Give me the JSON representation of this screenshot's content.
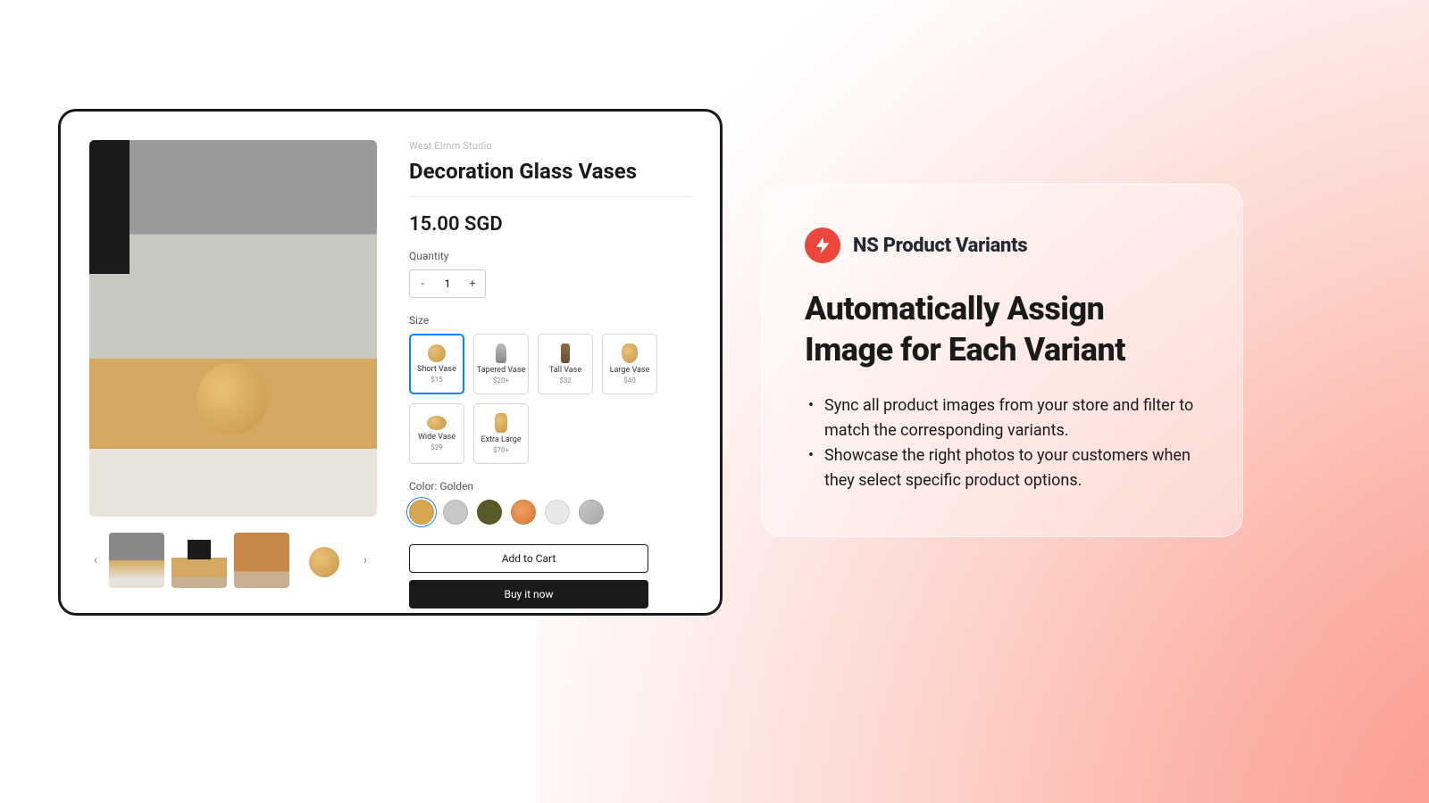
{
  "product": {
    "brand": "West Elmm Studio",
    "title": "Decoration Glass Vases",
    "price": "15.00 SGD",
    "quantity_label": "Quantity",
    "quantity_value": "1",
    "size_label": "Size",
    "sizes": [
      {
        "name": "Short Vase",
        "price": "$15",
        "selected": true
      },
      {
        "name": "Tapered Vase",
        "price": "$20+",
        "selected": false
      },
      {
        "name": "Tall Vase",
        "price": "$32",
        "selected": false
      },
      {
        "name": "Large Vase",
        "price": "$40",
        "selected": false
      },
      {
        "name": "Wide Vase",
        "price": "$29",
        "selected": false
      },
      {
        "name": "Extra Large",
        "price": "$70+",
        "selected": false
      }
    ],
    "color_label": "Color: Golden",
    "colors": [
      {
        "name": "Golden",
        "hex": "#d8a850",
        "selected": true
      },
      {
        "name": "Silver",
        "hex": "#c8c8c8",
        "selected": false
      },
      {
        "name": "Olive",
        "hex": "#5a5a28",
        "selected": false
      },
      {
        "name": "Copper",
        "hex": "#d87838",
        "selected": false
      },
      {
        "name": "White",
        "hex": "#e8e8e8",
        "selected": false
      },
      {
        "name": "Steel",
        "hex": "#a8a8a8",
        "selected": false
      }
    ],
    "add_to_cart": "Add to Cart",
    "buy_now": "Buy it now"
  },
  "feature": {
    "brand": "NS Product Variants",
    "title": "Automatically Assign Image for Each Variant",
    "bullets": [
      "Sync all product images from your store and filter to match the corresponding variants.",
      "Showcase the right photos to your customers when they select specific product options."
    ]
  }
}
